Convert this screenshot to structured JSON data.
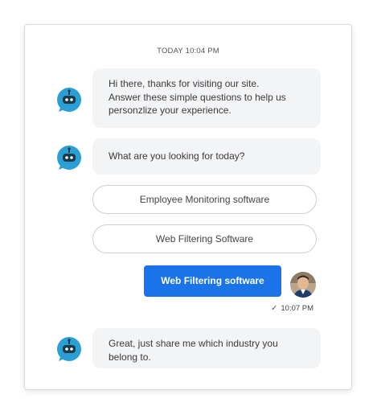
{
  "chat": {
    "timestamp": "TODAY 10:04 PM",
    "messages": [
      {
        "lines": [
          "Hi there, thanks for visiting our site.",
          "Answer these simple questions to help us",
          "personzlize your experience."
        ]
      },
      {
        "lines": [
          "What are you looking for today?"
        ]
      },
      {
        "lines": [
          "Great, just share me which industry you",
          "belong to."
        ]
      }
    ],
    "options": [
      "Employee Monitoring software",
      "Web Filtering Software"
    ],
    "user_reply": "Web Filtering software",
    "user_reply_time": "10:07 PM",
    "icons": {
      "bot": "chatbot-icon",
      "user": "user-avatar",
      "sent": "checkmark-icon"
    },
    "colors": {
      "bot_icon": "#2a9fd6",
      "user_bubble": "#1a73e8",
      "bot_bubble": "#f3f4f6"
    }
  }
}
